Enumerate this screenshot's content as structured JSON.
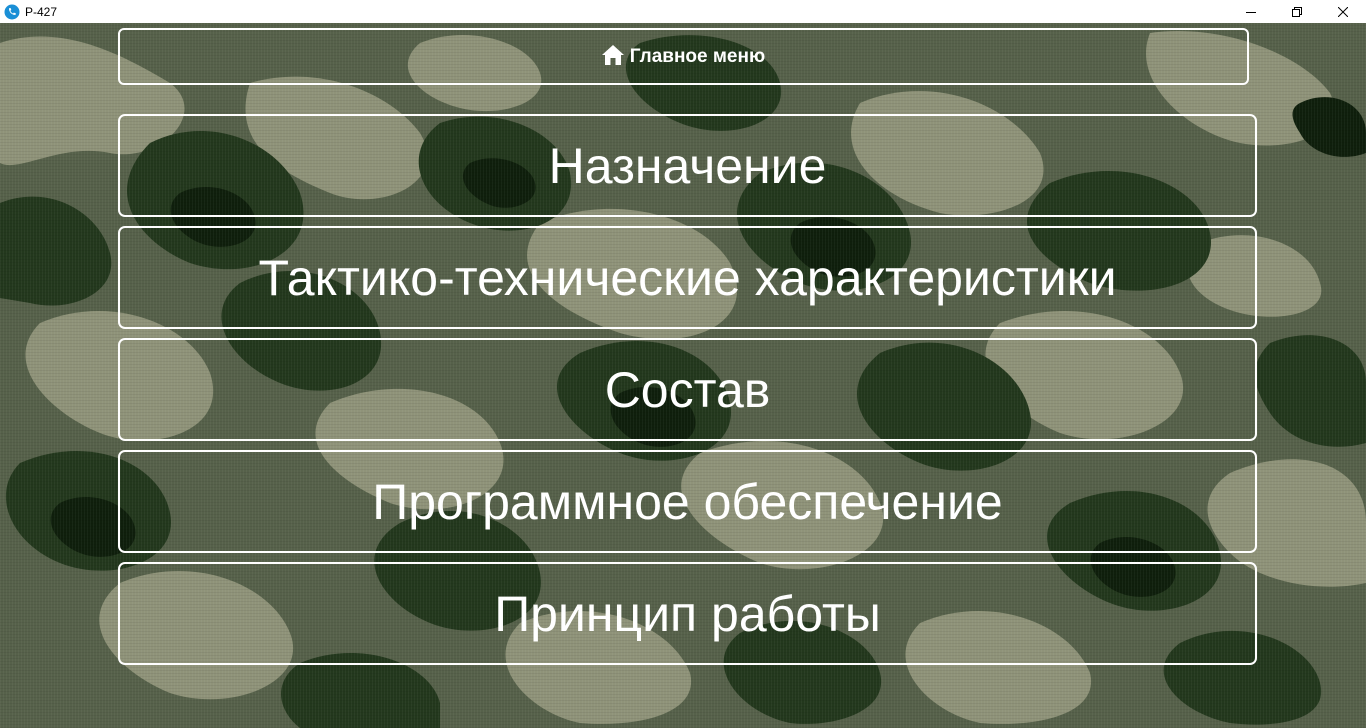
{
  "window": {
    "title": "Р-427",
    "icon": "phone-app-icon",
    "controls": [
      "minimize-icon",
      "restore-icon",
      "close-icon"
    ]
  },
  "colors": {
    "camo_light": "#8f9379",
    "camo_mid": "#4f5a43",
    "camo_dark": "#1d3418",
    "camo_darkest": "#0f1f0c",
    "border": "#ffffff",
    "text": "#ffffff"
  },
  "header": {
    "home_icon": "home-icon",
    "home_label": "Главное меню"
  },
  "menu": [
    {
      "label": "Назначение"
    },
    {
      "label": "Тактико-технические характеристики"
    },
    {
      "label": "Состав"
    },
    {
      "label": "Программное обеспечение"
    },
    {
      "label": "Принцип работы"
    }
  ]
}
